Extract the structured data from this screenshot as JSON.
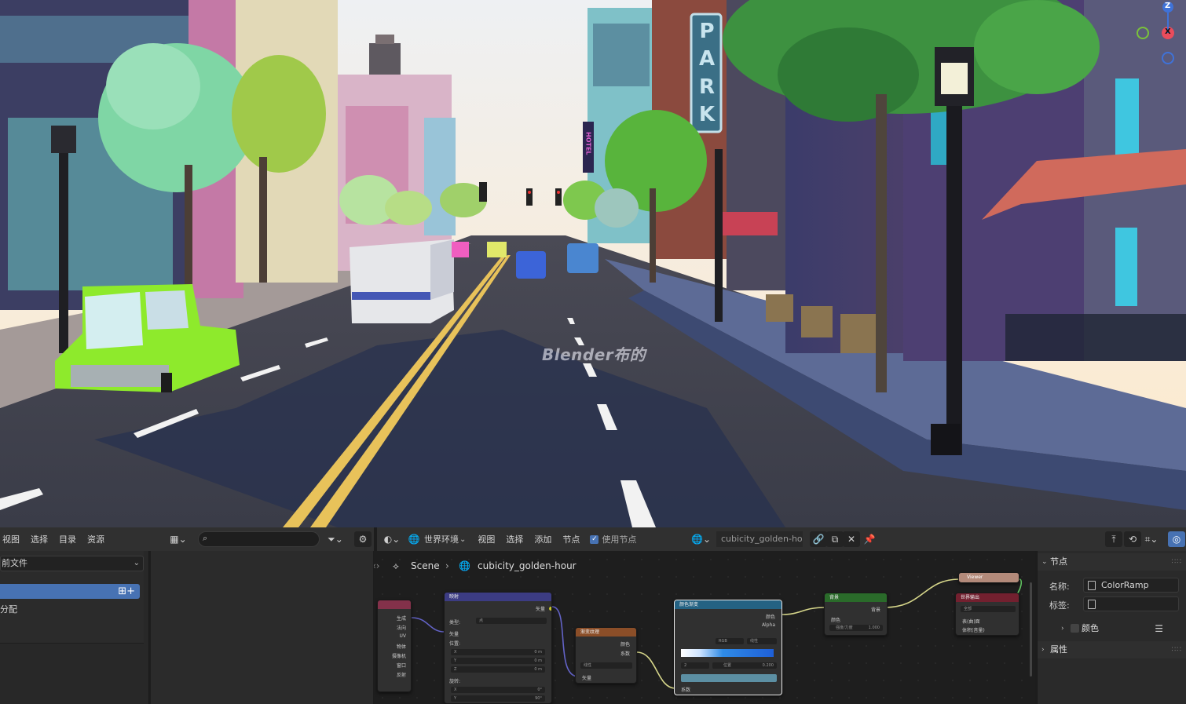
{
  "viewport": {
    "watermark": "Blender布的",
    "park_sign_letters": [
      "P",
      "A",
      "R",
      "K"
    ],
    "hotel_sign": "HOTEL",
    "gizmo": {
      "z": "Z",
      "x": "X"
    }
  },
  "asset_header": {
    "menus": [
      "视图",
      "选择",
      "目录",
      "资源"
    ]
  },
  "asset_panel": {
    "library_dropdown": "前文件",
    "list_item": "分配"
  },
  "node_header": {
    "editor_type": "世界环境",
    "menus": [
      "视图",
      "选择",
      "添加",
      "节点"
    ],
    "use_nodes_label": "使用节点",
    "world_name": "cubicity_golden-hour"
  },
  "breadcrumb": {
    "scene": "Scene",
    "world": "cubicity_golden-hour"
  },
  "nodes": {
    "texcoord": {
      "outputs": [
        "生成",
        "法向",
        "UV",
        "物体",
        "摄像机",
        "窗口",
        "反射"
      ]
    },
    "mapping": {
      "title": "映射",
      "output": "矢量",
      "type_label": "类型:",
      "type_value": "点",
      "vector_label": "矢量",
      "location_label": "位置:",
      "loc": [
        {
          "axis": "X",
          "value": "0 m"
        },
        {
          "axis": "Y",
          "value": "0 m"
        },
        {
          "axis": "Z",
          "value": "0 m"
        }
      ],
      "rotation_label": "旋转:",
      "rot": [
        {
          "axis": "X",
          "value": "0°"
        },
        {
          "axis": "Y",
          "value": "90°"
        }
      ]
    },
    "gradient": {
      "title": "渐变纹理",
      "out_color": "颜色",
      "out_fac": "系数",
      "type_value": "线性",
      "in_vector": "矢量"
    },
    "colorramp": {
      "title": "颜色渐变",
      "out_color": "颜色",
      "out_alpha": "Alpha",
      "mode": "RGB",
      "interp": "线性",
      "index": "2",
      "pos_label": "位置",
      "pos_value": "0.200",
      "in_fac": "系数"
    },
    "background": {
      "title": "背景",
      "output": "背景",
      "in_color": "颜色",
      "strength_label": "强度/力度",
      "strength_value": "1.000"
    },
    "viewer": {
      "title": "Viewer"
    },
    "world_output": {
      "title": "世界输出",
      "target": "全部",
      "in_surface": "表(曲)面",
      "in_volume": "体积(音量)"
    }
  },
  "props": {
    "node_section": "节点",
    "name_label": "名称:",
    "name_value": "ColorRamp",
    "label_label": "标签:",
    "label_value": "",
    "color_section": "颜色",
    "properties_section": "属性"
  },
  "colors": {
    "header_bg": "#303030",
    "editor_bg": "#1d1d1d",
    "accent": "#4772b3",
    "socket_yellow": "#c7c729",
    "socket_gray": "#a1a1a1",
    "socket_purple": "#6363c7",
    "socket_green": "#63c763"
  }
}
